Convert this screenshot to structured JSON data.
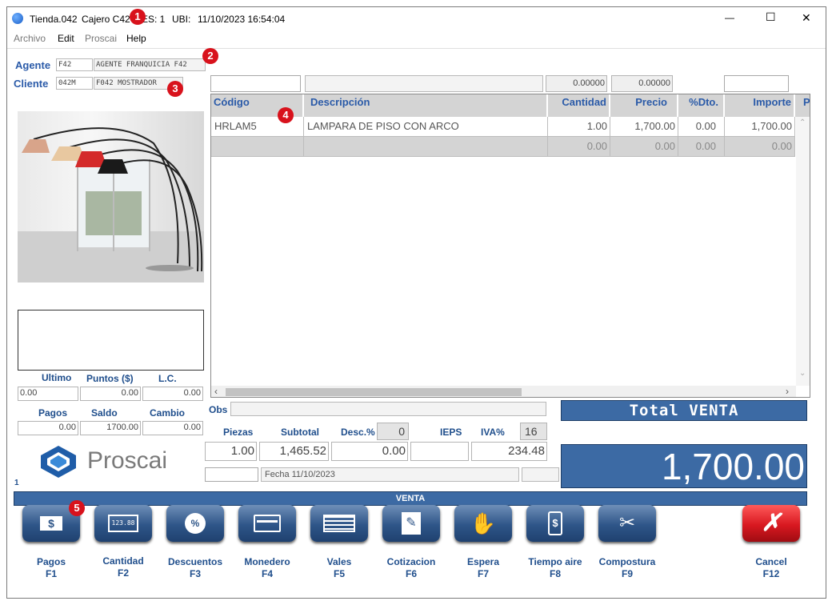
{
  "window": {
    "title_store": "Tienda.042",
    "title_cashier": "Cajero C42",
    "title_es": "ES: 1",
    "title_ubi_label": "UBI:",
    "title_datetime": "11/10/2023 16:54:04",
    "minimize": "—",
    "maximize": "☐",
    "close": "✕"
  },
  "menu": [
    "Archivo",
    "Edit",
    "Proscai",
    "Help"
  ],
  "badges": [
    "1",
    "2",
    "3",
    "4",
    "5"
  ],
  "agente": {
    "label": "Agente",
    "code": "F42",
    "name": "AGENTE FRANQUICIA F42"
  },
  "cliente": {
    "label": "Cliente",
    "code": "042M",
    "name": "F042 MOSTRADOR"
  },
  "entry_row": {
    "qty": "0.00000",
    "price": "0.00000"
  },
  "grid": {
    "columns": [
      "Código",
      "Descripción",
      "Cantidad",
      "Precio",
      "%Dto.",
      "Importe",
      "P"
    ],
    "rows": [
      {
        "codigo": "HRLAM5",
        "descripcion": "LAMPARA DE PISO CON ARCO",
        "cantidad": "1.00",
        "precio": "1,700.00",
        "dto": "0.00",
        "importe": "1,700.00"
      },
      {
        "codigo": "",
        "descripcion": "",
        "cantidad": "0.00",
        "precio": "0.00",
        "dto": "0.00",
        "importe": "0.00"
      }
    ]
  },
  "balances": {
    "labels": [
      "Ultimo",
      "Puntos ($)",
      "L.C."
    ],
    "values": [
      "0.00",
      "0.00",
      "0.00"
    ]
  },
  "payments": {
    "labels": [
      "Pagos",
      "Saldo",
      "Cambio"
    ],
    "values": [
      "0.00",
      "1700.00",
      "0.00"
    ]
  },
  "brand": {
    "name": "Proscai"
  },
  "status_num": "1",
  "obs_label": "Obs",
  "totals": {
    "labels": [
      "Piezas",
      "Subtotal",
      "Desc.%",
      "IEPS",
      "IVA%"
    ],
    "desc_pct": "0",
    "iva_pct": "16",
    "piezas": "1.00",
    "subtotal": "1,465.52",
    "descuento": "0.00",
    "ieps": "",
    "iva": "234.48",
    "fecha": "Fecha 11/10/2023"
  },
  "total_venta": {
    "label": "Total VENTA",
    "amount": "1,700.00"
  },
  "mode_bar": "VENTA",
  "fkeys": [
    {
      "label": "Pagos",
      "key": "F1"
    },
    {
      "label": "Cantidad",
      "key": "F2"
    },
    {
      "label": "Descuentos",
      "key": "F3"
    },
    {
      "label": "Monedero",
      "key": "F4"
    },
    {
      "label": "Vales",
      "key": "F5"
    },
    {
      "label": "Cotizacion",
      "key": "F6"
    },
    {
      "label": "Espera",
      "key": "F7"
    },
    {
      "label": "Tiempo aire",
      "key": "F8"
    },
    {
      "label": "Compostura",
      "key": "F9"
    },
    {
      "label": "Cancel",
      "key": "F12"
    }
  ],
  "colors": {
    "accent": "#3c6aa4",
    "label_blue": "#2a5aa8",
    "cancel_red": "#d81820",
    "badge": "#d8121c"
  }
}
